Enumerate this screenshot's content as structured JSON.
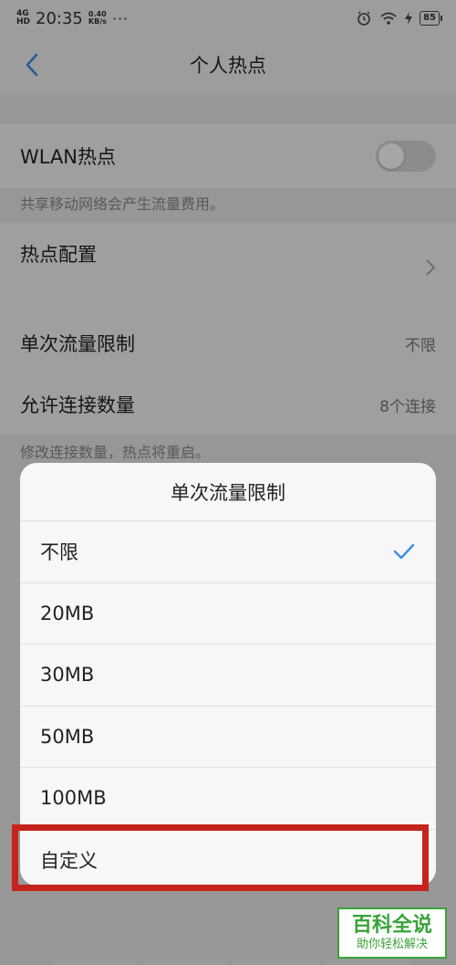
{
  "status_bar": {
    "network": "4G",
    "network_sub": "HD",
    "time": "20:35",
    "speed_value": "0.40",
    "speed_unit": "KB/s",
    "dots": "···",
    "battery": "85"
  },
  "header": {
    "title": "个人热点"
  },
  "settings": {
    "wlan_hotspot_label": "WLAN热点",
    "wlan_hotspot_enabled": false,
    "wlan_hint": "共享移动网络会产生流量费用。",
    "hotspot_config_label": "热点配置",
    "data_limit_label": "单次流量限制",
    "data_limit_value": "不限",
    "connections_label": "允许连接数量",
    "connections_value": "8个连接",
    "connections_hint": "修改连接数量，热点将重启。"
  },
  "sheet": {
    "title": "单次流量限制",
    "options": [
      {
        "label": "不限",
        "selected": true
      },
      {
        "label": "20MB",
        "selected": false
      },
      {
        "label": "30MB",
        "selected": false
      },
      {
        "label": "50MB",
        "selected": false
      },
      {
        "label": "100MB",
        "selected": false
      },
      {
        "label": "自定义",
        "selected": false
      }
    ]
  },
  "watermark": {
    "brand": "百科全说",
    "tagline": "助你轻松解决"
  },
  "colors": {
    "accent": "#3a8ee6",
    "highlight": "#c4241c",
    "watermark": "#3aa33a"
  }
}
